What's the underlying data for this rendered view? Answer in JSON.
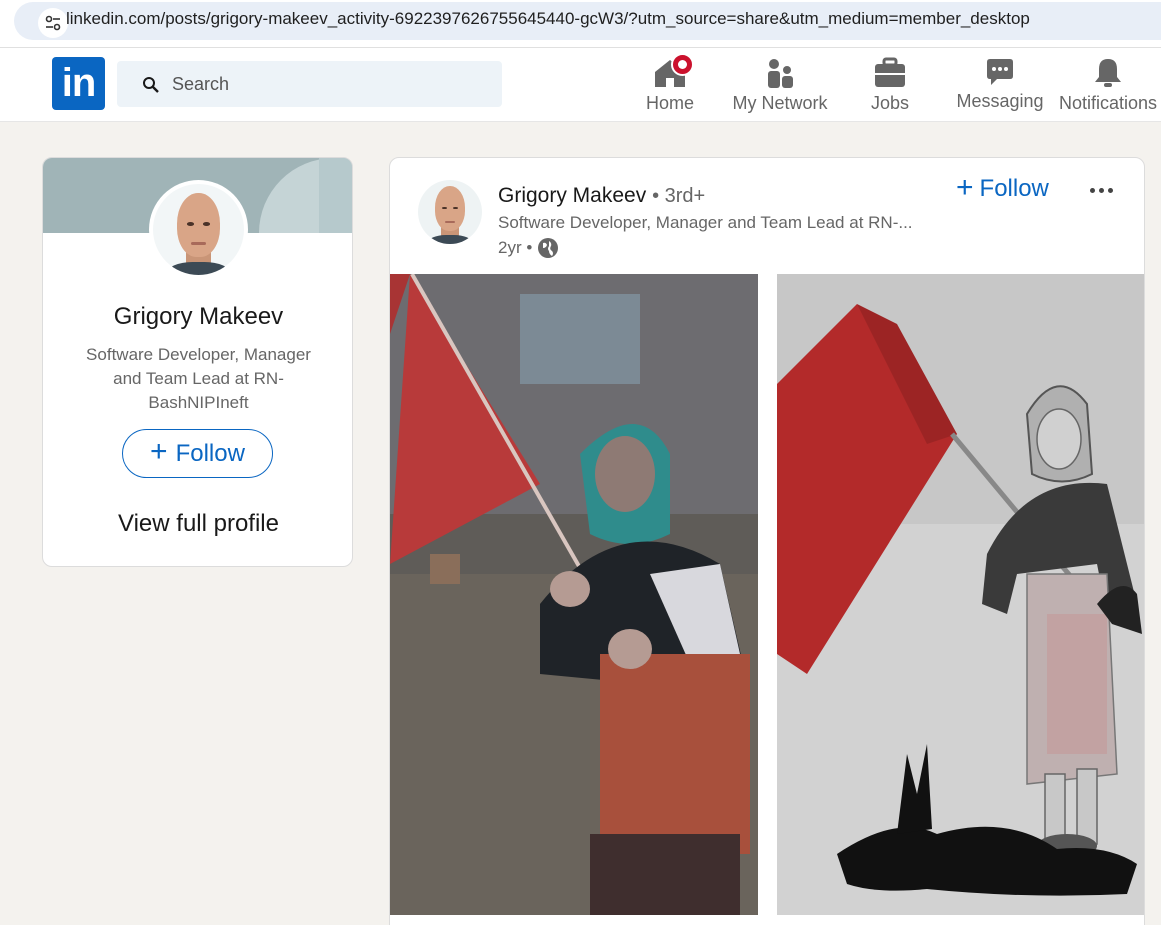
{
  "browser": {
    "url": "linkedin.com/posts/grigory-makeev_activity-6922397626755645440-gcW3/?utm_source=share&utm_medium=member_desktop",
    "site_info_icon": "tune-icon"
  },
  "nav": {
    "logo_text": "in",
    "search_placeholder": "Search",
    "items": [
      {
        "label": "Home",
        "icon": "home-icon",
        "has_badge": true
      },
      {
        "label": "My Network",
        "icon": "network-icon"
      },
      {
        "label": "Jobs",
        "icon": "briefcase-icon"
      },
      {
        "label": "Messaging",
        "icon": "messaging-icon"
      },
      {
        "label": "Notifications",
        "icon": "bell-icon"
      }
    ],
    "brand_color": "#0a66c2",
    "badge_color": "#cb112d"
  },
  "profile": {
    "name": "Grigory Makeev",
    "headline": "Software Developer, Manager and Team Lead at RN-BashNIPIneft",
    "follow_label": "Follow",
    "view_profile_label": "View full profile"
  },
  "post": {
    "author_name": "Grigory Makeev",
    "degree": "• 3rd+",
    "author_headline": "Software Developer, Manager and Team Lead at RN-...",
    "time": "2yr •",
    "visibility_icon": "globe-icon",
    "follow_label": "Follow",
    "menu_icon": "more-horizontal-icon"
  }
}
